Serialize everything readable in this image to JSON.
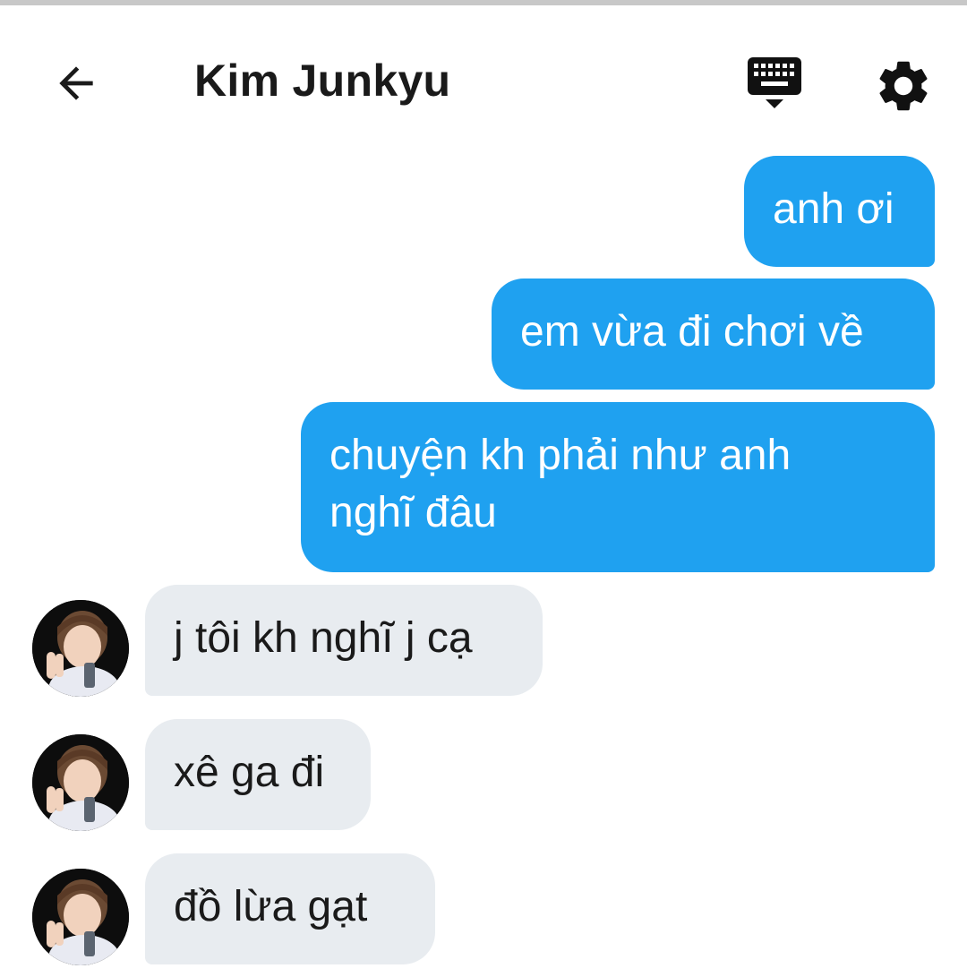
{
  "header": {
    "title": "Kim Junkyu",
    "icons": {
      "back": "arrow-left-icon",
      "keyboard": "keyboard-icon",
      "settings": "gear-icon"
    }
  },
  "colors": {
    "outgoing_bubble": "#1fa1f0",
    "incoming_bubble": "#e8ecf0",
    "text_dark": "#1a1a1a"
  },
  "messages": [
    {
      "direction": "out",
      "text": "anh ơi"
    },
    {
      "direction": "out",
      "text": "em vừa đi chơi về"
    },
    {
      "direction": "out",
      "text": "chuyện kh phải như anh nghĩ đâu"
    },
    {
      "direction": "in",
      "text": "j tôi kh nghĩ j cạ"
    },
    {
      "direction": "in",
      "text": "xê ga đi"
    },
    {
      "direction": "in",
      "text": "đồ lừa gạt"
    }
  ]
}
